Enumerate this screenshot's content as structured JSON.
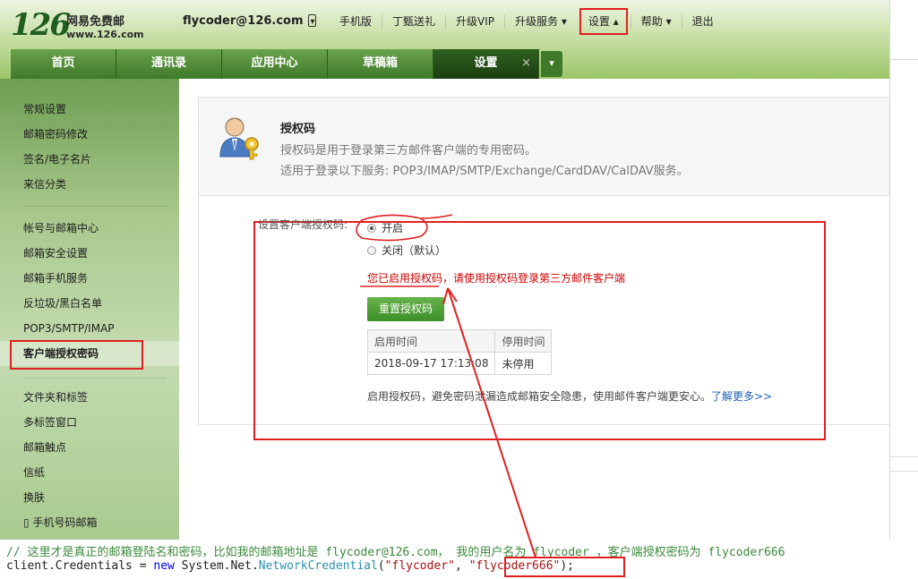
{
  "header": {
    "logo_number": "126",
    "logo_name": "网易免费邮",
    "logo_url": "www.126.com",
    "account": "flycoder@126.com",
    "nav": [
      "手机版",
      "丁甄送礼",
      "升级VIP",
      "升级服务",
      "设置",
      "帮助",
      "退出"
    ],
    "tabs": [
      {
        "label": "首页"
      },
      {
        "label": "通讯录"
      },
      {
        "label": "应用中心"
      },
      {
        "label": "草稿箱"
      },
      {
        "label": "设置",
        "close": "×"
      }
    ]
  },
  "sidebar": {
    "group1": [
      "常规设置",
      "邮箱密码修改",
      "签名/电子名片",
      "来信分类"
    ],
    "group2": [
      "帐号与邮箱中心",
      "邮箱安全设置",
      "邮箱手机服务",
      "反垃圾/黑白名单",
      "POP3/SMTP/IMAP",
      "客户端授权密码"
    ],
    "group3": [
      "文件夹和标签",
      "多标签窗口",
      "邮箱触点",
      "信纸",
      "换肤",
      "手机号码邮箱"
    ]
  },
  "main": {
    "title": "授权码",
    "desc1": "授权码是用于登录第三方邮件客户端的专用密码。",
    "desc2": "适用于登录以下服务: POP3/IMAP/SMTP/Exchange/CardDAV/CalDAV服务。",
    "field_label": "设置客户端授权码:",
    "opt_on": "开启",
    "opt_off": "关闭（默认）",
    "enabled_msg": "您已启用授权码，请使用授权码登录第三方邮件客户端",
    "reset_button": "重置授权码",
    "table": {
      "headers": [
        "启用时间",
        "停用时间"
      ],
      "row": [
        "2018-09-17 17:13:08",
        "未停用"
      ]
    },
    "note": "启用授权码，避免密码泄漏造成邮箱安全隐患，使用邮件客户端更安心。",
    "learn_more": "了解更多>>"
  },
  "code": {
    "comment": "// 这里才是真正的邮箱登陆名和密码，比如我的邮箱地址是 flycoder@126.com， 我的用户名为 flycoder ，客户端授权密码为 flycoder666",
    "stmt_prefix": "client.Credentials = ",
    "kw_new": "new",
    "ns": " System.Net.",
    "type": "NetworkCredential",
    "open": "(",
    "arg1": "\"flycoder\"",
    "comma": ", ",
    "arg2": "\"flycoder666\"",
    "close": ");"
  },
  "colors": {
    "annotation_red": "#e02020",
    "brand_green": "#3f7a2b"
  }
}
